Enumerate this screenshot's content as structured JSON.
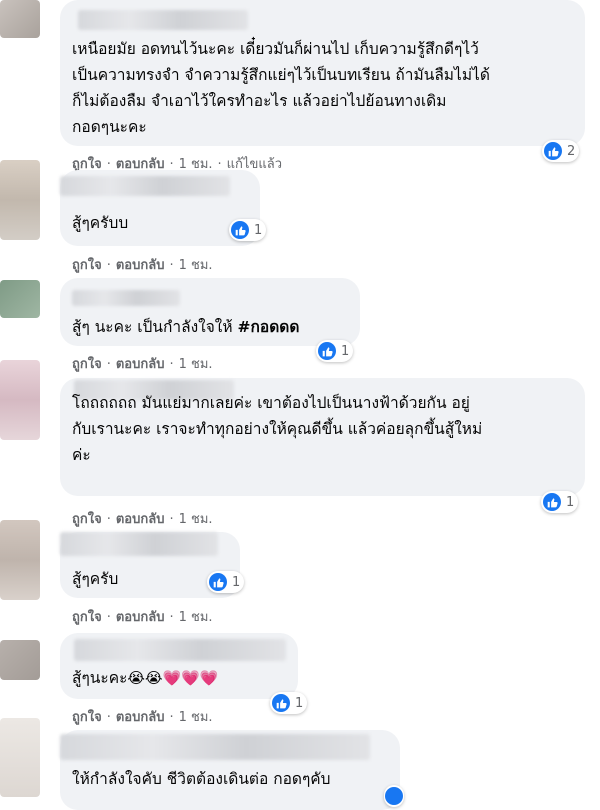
{
  "actions": {
    "like": "ถูกใจ",
    "reply": "ตอบกลับ",
    "edited": "แก้ไขแล้ว"
  },
  "comments": [
    {
      "text": "เหนือยมัย อดทนไว้นะคะ เดี๋ยวมันก็ผ่านไป เก็บความรู้สึกดีๆไว้\nเป็นความทรงจำ จำความรู้สึกแย่ๆไว้เป็นบทเรียน ถ้ามันลืมไม่ได้\nก็ไม่ต้องลืม จำเอาไว้ใครทำอะไร แล้วอย่าไปย้อนทางเดิม\nกอดๆนะคะ",
      "time": "1 ชม.",
      "likes": "2"
    },
    {
      "text": "สู้ๆครับบ",
      "time": "1 ชม.",
      "likes": "1"
    },
    {
      "text": "สู้ๆ นะคะ เป็นกำลังใจให้ ",
      "hashtag": "#กอดดด",
      "time": "1 ชม.",
      "likes": "1"
    },
    {
      "text": "โถถถถถถ มันแย่มากเลยค่ะ เขาต้องไปเป็นนางฟ้าด้วยกัน อยู่\nกับเรานะคะ เราจะทำทุกอย่างให้คุณดีขึ้น แล้วค่อยลุกขึ้นสู้ใหม่\nค่ะ",
      "time": "1 ชม.",
      "likes": "1"
    },
    {
      "text": "สู้ๆครับ",
      "time": "1 ชม.",
      "likes": "1"
    },
    {
      "text": "สู้ๆนะคะ",
      "emojis": [
        "😭",
        "😭",
        "💗",
        "💗",
        "💗"
      ],
      "time": "1 ชม.",
      "likes": "1"
    },
    {
      "text": "ให้กำลังใจคับ ชีวิตต้องเดินต่อ กอดๆคับ"
    }
  ],
  "colors": {
    "like_blue": "#1877f2",
    "bubble_bg": "#f0f2f5",
    "meta_gray": "#65676b"
  }
}
